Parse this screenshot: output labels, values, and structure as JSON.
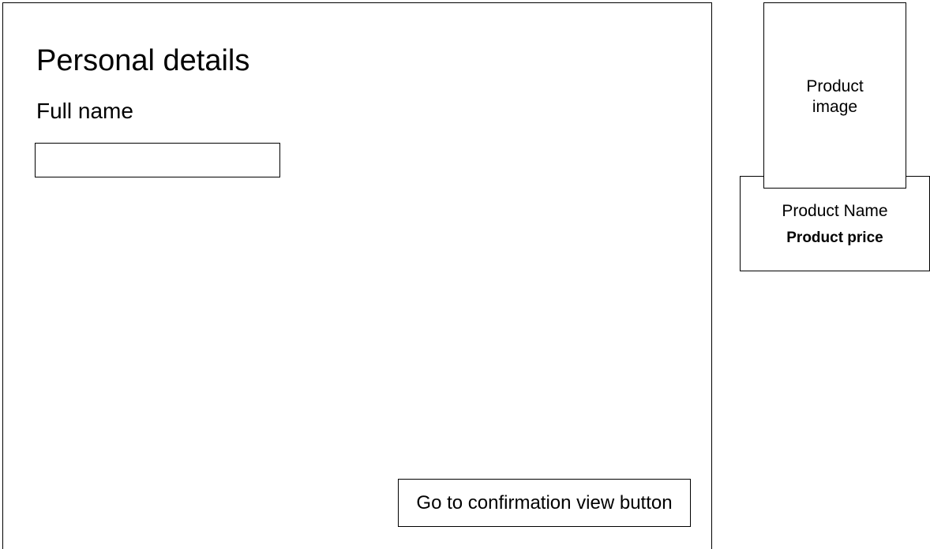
{
  "personal_details": {
    "title": "Personal details",
    "full_name_label": "Full name",
    "full_name_value": "",
    "full_name_placeholder": ""
  },
  "actions": {
    "confirm_button_label": "Go to confirmation view button"
  },
  "product": {
    "image_label": "Product\nimage",
    "name": "Product Name",
    "price": "Product price"
  }
}
